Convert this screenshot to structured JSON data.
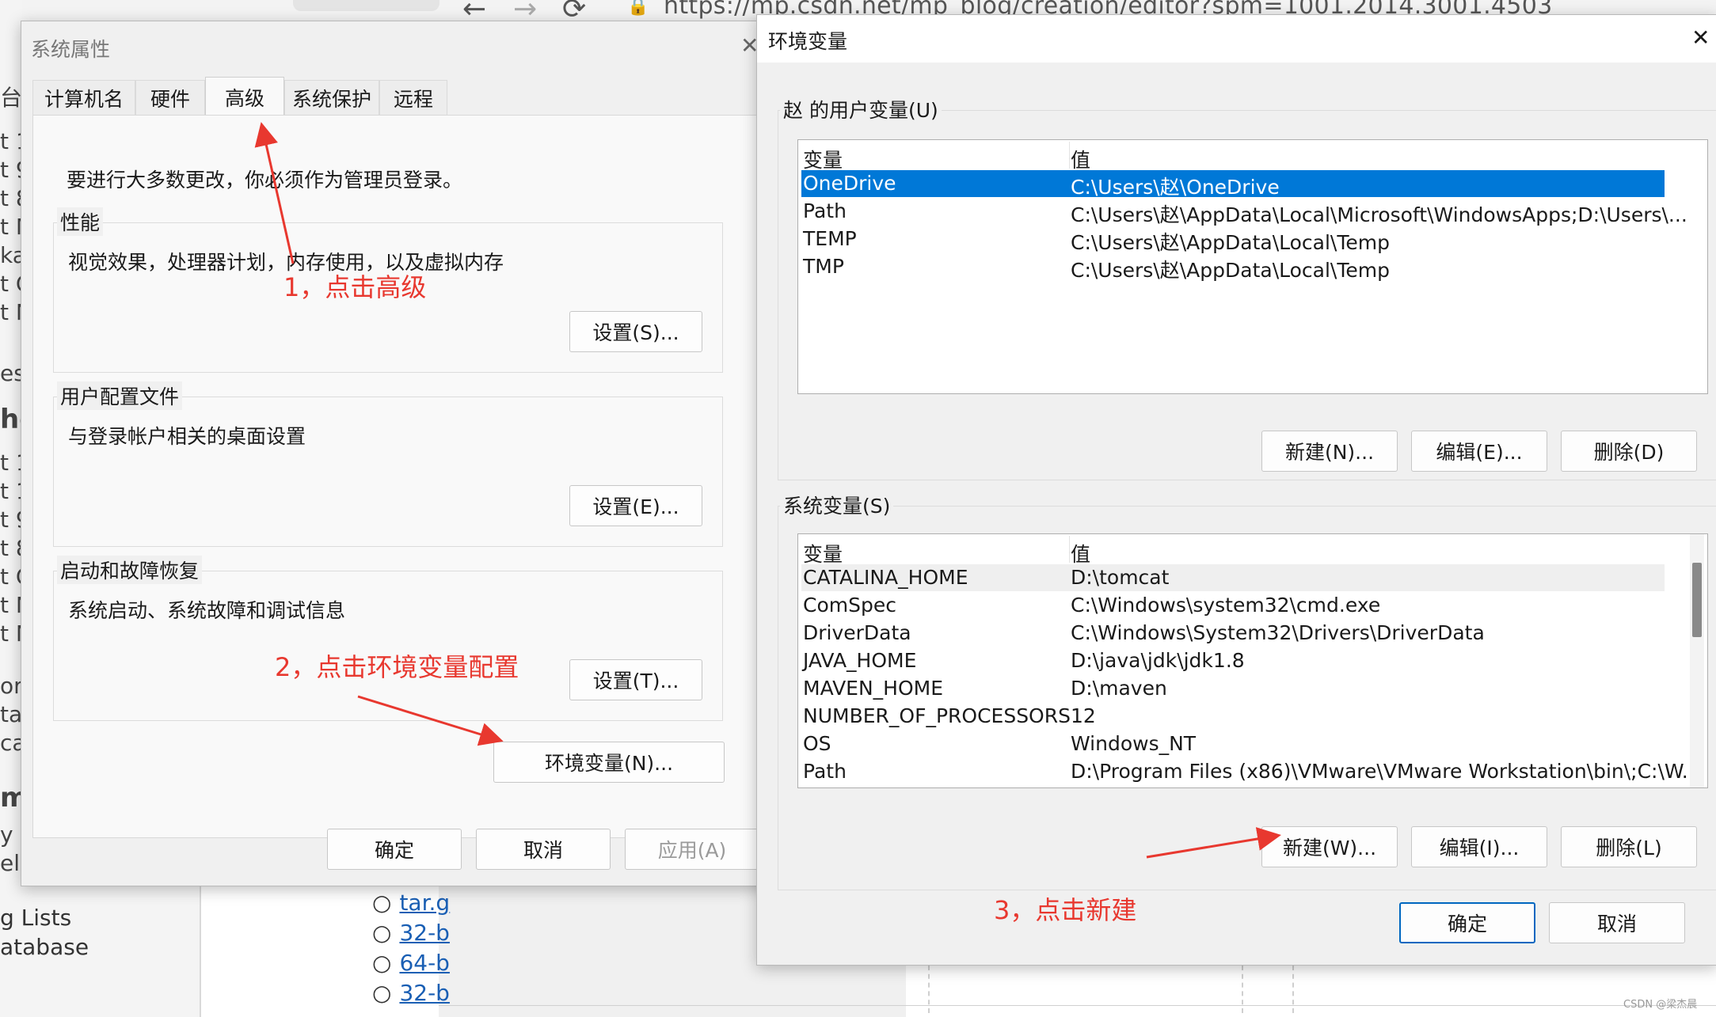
{
  "browser": {
    "back_icon": "←",
    "forward_icon": "→",
    "reload_icon": "⟳",
    "lock_icon": "🔒",
    "url": "https://mp.csdn.net/mp_blog/creation/editor?spm=1001.2014.3001.4503"
  },
  "background_page": {
    "edge_fragments": [
      "台",
      "t 1",
      "t 9",
      "t 8",
      "t M",
      "ka",
      "t C",
      "t N",
      "es",
      "he",
      "t 1",
      "t 1",
      "t 9",
      "t 8",
      "t C",
      "t N",
      "t N",
      "or",
      "ta",
      "ca",
      "m",
      "y l",
      "elp"
    ],
    "left_links": [
      "g Lists",
      "atabase"
    ],
    "list_items": [
      "tar.g",
      "32-b",
      "64-b",
      "32-b"
    ],
    "watermark": "CSDN @梁杰晨"
  },
  "system_properties": {
    "title": "系统属性",
    "close_icon": "✕",
    "tabs": [
      "计算机名",
      "硬件",
      "高级",
      "系统保护",
      "远程"
    ],
    "active_tab": "高级",
    "admin_note": "要进行大多数更改，你必须作为管理员登录。",
    "performance": {
      "title": "性能",
      "desc": "视觉效果，处理器计划，内存使用，以及虚拟内存",
      "button": "设置(S)..."
    },
    "user_profile": {
      "title": "用户配置文件",
      "desc": "与登录帐户相关的桌面设置",
      "button": "设置(E)..."
    },
    "startup": {
      "title": "启动和故障恢复",
      "desc": "系统启动、系统故障和调试信息",
      "button": "设置(T)..."
    },
    "env_button": "环境变量(N)...",
    "ok": "确定",
    "cancel": "取消",
    "apply": "应用(A)"
  },
  "environment_variables": {
    "title": "环境变量",
    "close_icon": "✕",
    "user_section": {
      "title": "赵 的用户变量(U)",
      "col_var": "变量",
      "col_val": "值",
      "rows": [
        {
          "name": "OneDrive",
          "value": "C:\\Users\\赵\\OneDrive"
        },
        {
          "name": "Path",
          "value": "C:\\Users\\赵\\AppData\\Local\\Microsoft\\WindowsApps;D:\\Users\\..."
        },
        {
          "name": "TEMP",
          "value": "C:\\Users\\赵\\AppData\\Local\\Temp"
        },
        {
          "name": "TMP",
          "value": "C:\\Users\\赵\\AppData\\Local\\Temp"
        }
      ],
      "new": "新建(N)...",
      "edit": "编辑(E)...",
      "delete": "删除(D)"
    },
    "system_section": {
      "title": "系统变量(S)",
      "col_var": "变量",
      "col_val": "值",
      "rows": [
        {
          "name": "CATALINA_HOME",
          "value": "D:\\tomcat"
        },
        {
          "name": "ComSpec",
          "value": "C:\\Windows\\system32\\cmd.exe"
        },
        {
          "name": "DriverData",
          "value": "C:\\Windows\\System32\\Drivers\\DriverData"
        },
        {
          "name": "JAVA_HOME",
          "value": "D:\\java\\jdk\\jdk1.8"
        },
        {
          "name": "MAVEN_HOME",
          "value": "D:\\maven"
        },
        {
          "name": "NUMBER_OF_PROCESSORS",
          "value": "12"
        },
        {
          "name": "OS",
          "value": "Windows_NT"
        },
        {
          "name": "Path",
          "value": "D:\\Program Files (x86)\\VMware\\VMware Workstation\\bin\\;C:\\W..."
        }
      ],
      "new": "新建(W)...",
      "edit": "编辑(I)...",
      "delete": "删除(L)"
    },
    "ok": "确定",
    "cancel": "取消"
  },
  "annotations": {
    "step1": "1，点击高级",
    "step2": "2，点击环境变量配置",
    "step3": "3，点击新建"
  },
  "colors": {
    "selection": "#0078d7",
    "annotation": "#e8382f",
    "primary_border": "#0067c0",
    "link": "#1a5fb4"
  }
}
